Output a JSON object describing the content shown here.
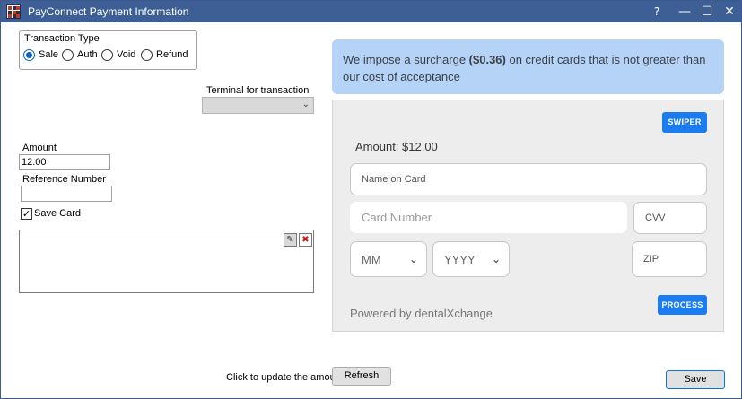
{
  "window": {
    "title": "PayConnect Payment Information",
    "help_label": "?",
    "minimize_label": "—",
    "maximize_label": "☐",
    "close_label": "✕"
  },
  "transaction_type": {
    "label": "Transaction Type",
    "options": [
      {
        "label": "Sale",
        "checked": true
      },
      {
        "label": "Auth",
        "checked": false
      },
      {
        "label": "Void",
        "checked": false
      },
      {
        "label": "Refund",
        "checked": false
      }
    ]
  },
  "terminal": {
    "label": "Terminal for transaction",
    "value": ""
  },
  "amount": {
    "label": "Amount",
    "value": "12.00"
  },
  "reference": {
    "label": "Reference Number",
    "value": ""
  },
  "save_card": {
    "label": "Save Card",
    "checked": true,
    "check_glyph": "✓"
  },
  "signature": {
    "edit_glyph": "✎",
    "clear_glyph": "✖"
  },
  "surcharge": {
    "text_before": "We impose a surcharge ",
    "amount": "($0.36)",
    "text_after": " on credit cards that is not greater than our cost of acceptance"
  },
  "payment_form": {
    "swiper_label": "SWIPER",
    "amount_text": "Amount: $12.00",
    "name_placeholder": "Name on Card",
    "card_number_placeholder": "Card Number",
    "cvv_placeholder": "CVV",
    "month_placeholder": "MM",
    "year_placeholder": "YYYY",
    "zip_placeholder": "ZIP",
    "process_label": "PROCESS",
    "powered_by": "Powered by dentalXchange",
    "chevron_glyph": "⌄"
  },
  "footer": {
    "update_hint": "Click to update the amount",
    "refresh_label": "Refresh",
    "save_label": "Save"
  },
  "colors": {
    "titlebar": "#3d5f96",
    "banner": "#b4d3f7",
    "accent_button": "#1a7cf0",
    "panel": "#ededed"
  }
}
